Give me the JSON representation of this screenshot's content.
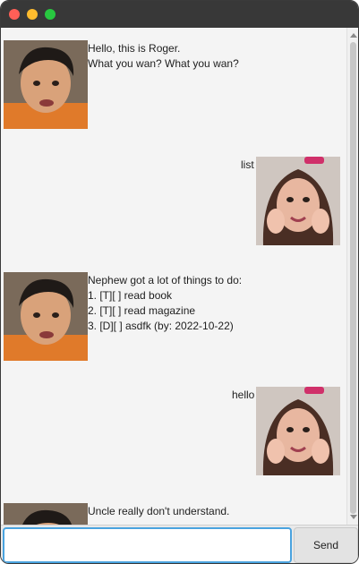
{
  "window": {
    "controls": [
      "close-button",
      "minimize-button",
      "maximize-button"
    ]
  },
  "messages": [
    {
      "sender": "bot",
      "avatar": "uncle-roger-avatar",
      "text": "Hello, this is Roger.\nWhat you wan? What you wan?"
    },
    {
      "sender": "user",
      "avatar": "nephew-avatar",
      "text": "list"
    },
    {
      "sender": "bot",
      "avatar": "uncle-roger-avatar",
      "text": "Nephew got a lot of things to do:\n1. [T][ ] read book\n2. [T][ ] read magazine\n3. [D][ ] asdfk (by: 2022-10-22)"
    },
    {
      "sender": "user",
      "avatar": "nephew-avatar",
      "text": "hello"
    },
    {
      "sender": "bot",
      "avatar": "uncle-roger-avatar",
      "text": "Uncle really don't understand."
    }
  ],
  "input": {
    "value": "",
    "placeholder": ""
  },
  "send": {
    "label": "Send"
  },
  "colors": {
    "titlebar": "#383838",
    "chat_bg": "#f4f4f4",
    "input_focus": "#4aa3df"
  }
}
